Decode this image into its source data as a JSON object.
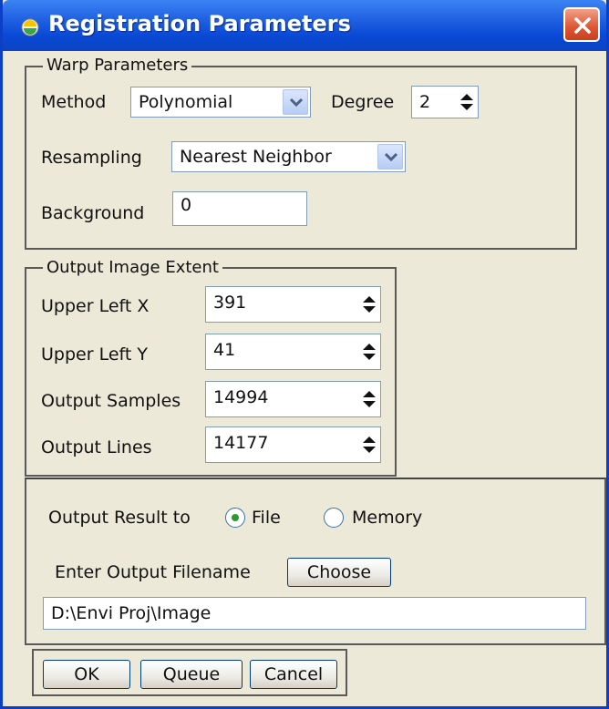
{
  "window": {
    "title": "Registration Parameters"
  },
  "warp": {
    "legend": "Warp Parameters",
    "method_label": "Method",
    "method_value": "Polynomial",
    "degree_label": "Degree",
    "degree_value": "2",
    "resampling_label": "Resampling",
    "resampling_value": "Nearest Neighbor",
    "background_label": "Background",
    "background_value": "0"
  },
  "extent": {
    "legend": "Output Image Extent",
    "rows": [
      {
        "label": "Upper Left X",
        "value": "391"
      },
      {
        "label": "Upper Left Y",
        "value": "41"
      },
      {
        "label": "Output Samples",
        "value": "14994"
      },
      {
        "label": "Output Lines",
        "value": "14177"
      }
    ]
  },
  "output": {
    "result_label": "Output Result to",
    "option_file": "File",
    "option_memory": "Memory",
    "selected": "File",
    "filename_label": "Enter Output Filename",
    "choose_label": "Choose",
    "filename_value": "D:\\Envi Proj\\Image"
  },
  "buttons": {
    "ok": "OK",
    "queue": "Queue",
    "cancel": "Cancel"
  },
  "colors": {
    "titlebar": "#0a49d6",
    "window_bg": "#ece9d8",
    "close": "#dd5533"
  }
}
